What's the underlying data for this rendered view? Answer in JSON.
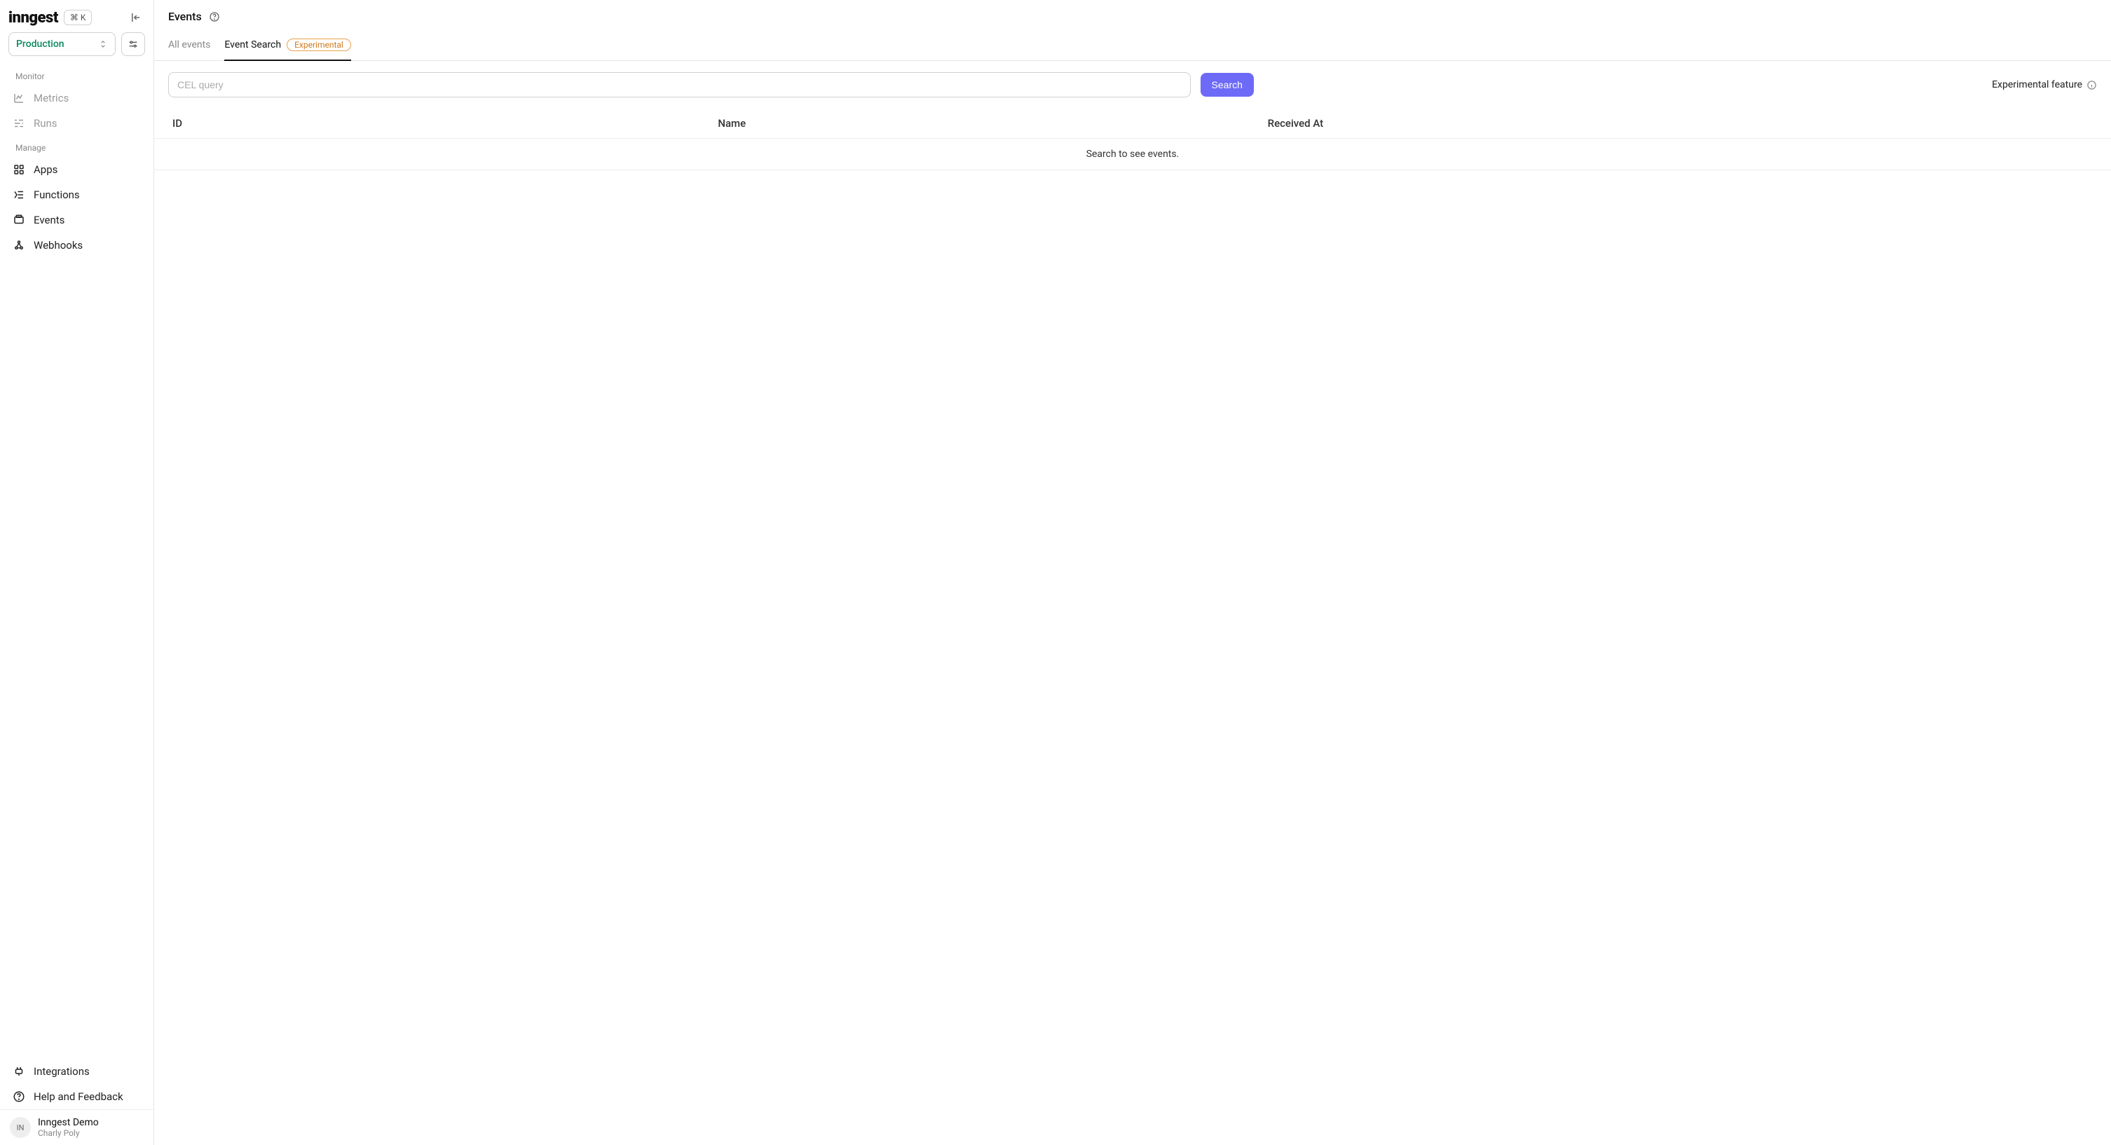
{
  "brand": {
    "name": "inngest",
    "shortcut": "⌘ K"
  },
  "env": {
    "selected": "Production"
  },
  "sidebar": {
    "sections": {
      "monitor": {
        "label": "Monitor",
        "items": [
          {
            "label": "Metrics"
          },
          {
            "label": "Runs"
          }
        ]
      },
      "manage": {
        "label": "Manage",
        "items": [
          {
            "label": "Apps"
          },
          {
            "label": "Functions"
          },
          {
            "label": "Events"
          },
          {
            "label": "Webhooks"
          }
        ]
      }
    },
    "bottom": [
      {
        "label": "Integrations"
      },
      {
        "label": "Help and Feedback"
      }
    ]
  },
  "footer": {
    "avatar_initials": "IN",
    "org": "Inngest Demo",
    "user": "Charly Poly"
  },
  "header": {
    "title": "Events"
  },
  "tabs": [
    {
      "label": "All events"
    },
    {
      "label": "Event Search",
      "badge": "Experimental"
    }
  ],
  "search": {
    "placeholder": "CEL query",
    "button": "Search",
    "note": "Experimental feature"
  },
  "table": {
    "columns": [
      "ID",
      "Name",
      "Received At"
    ],
    "empty_message": "Search to see events."
  }
}
